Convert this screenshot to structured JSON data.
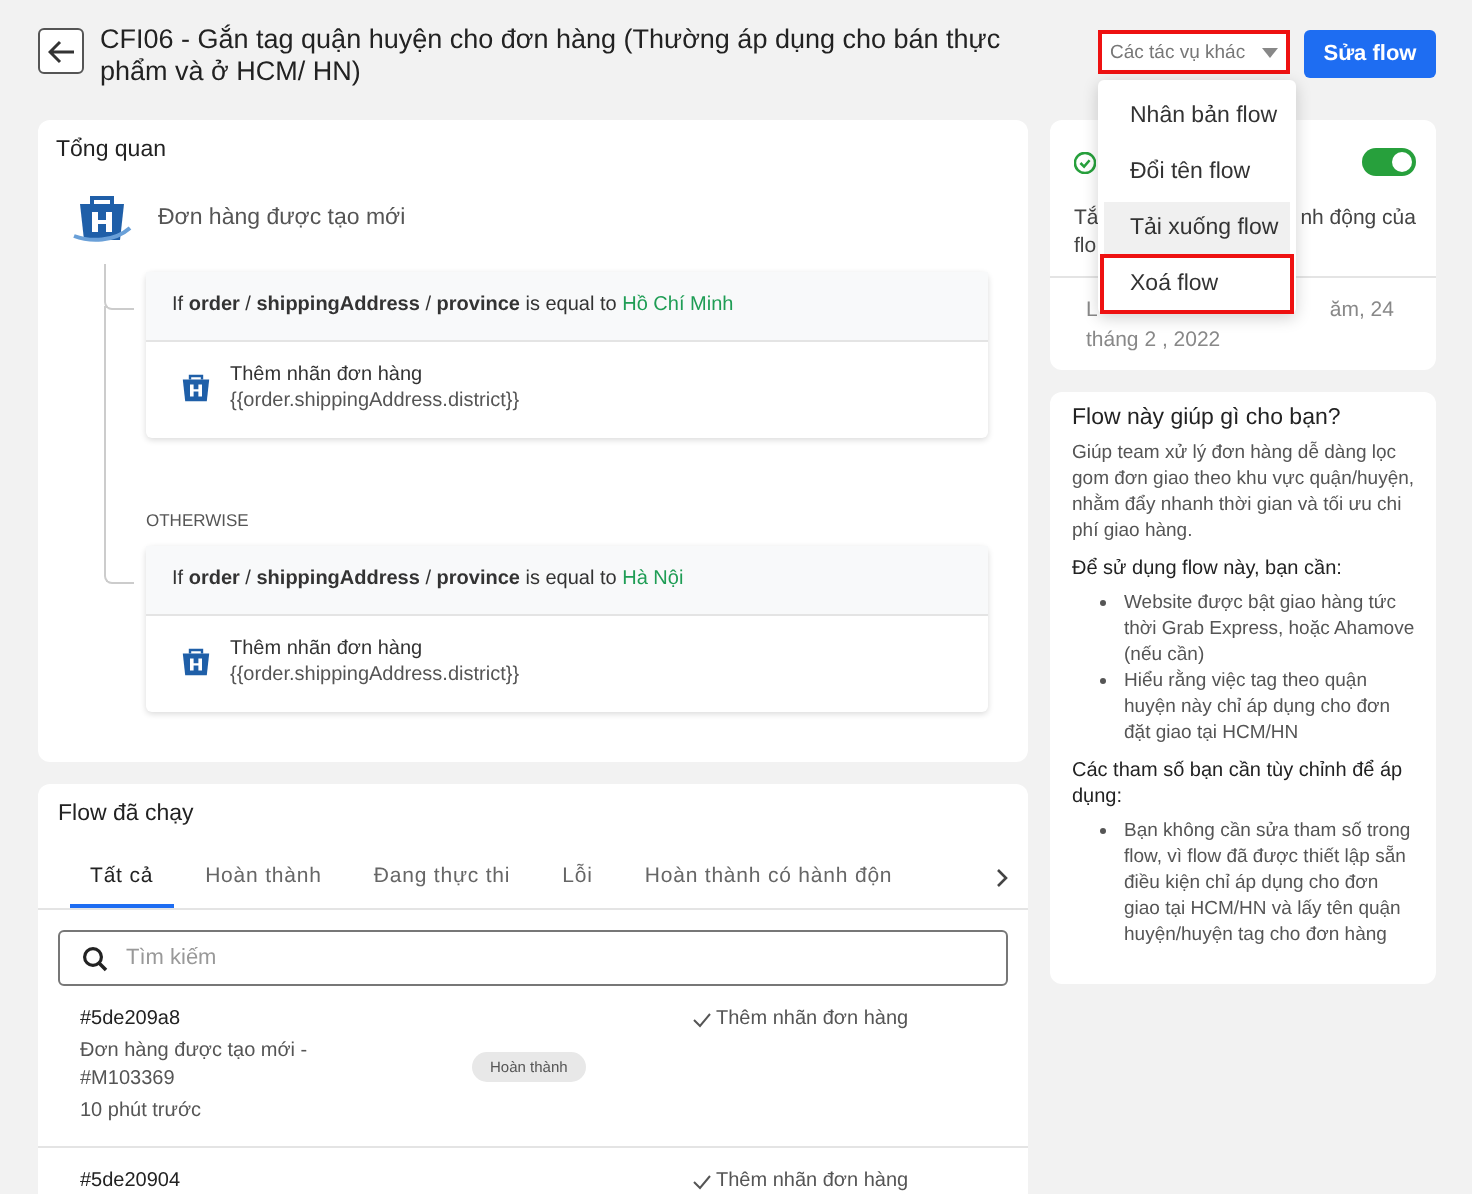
{
  "header": {
    "title": "CFI06 - Gắn tag quận huyện cho đơn hàng (Thường áp dụng cho bán thực phẩm và ở HCM/ HN)",
    "more_actions": "Các tác vụ khác",
    "edit_button": "Sửa flow"
  },
  "actions_menu": {
    "open": true,
    "items": [
      {
        "label": "Nhân bản flow",
        "hovered": false,
        "outlined": false
      },
      {
        "label": "Đổi tên flow",
        "hovered": false,
        "outlined": false
      },
      {
        "label": "Tải xuống flow",
        "hovered": true,
        "outlined": false
      },
      {
        "label": "Xoá flow",
        "hovered": false,
        "outlined": true
      }
    ]
  },
  "overview": {
    "title": "Tổng quan",
    "trigger": "Đơn hàng được tạo mới",
    "otherwise": "OTHERWISE",
    "branches": [
      {
        "condition": "If **order** / **shippingAddress** / **province** is equal to",
        "value": "Hồ Chí Minh",
        "action": "Thêm nhãn đơn hàng",
        "param": "{{order.shippingAddress.district}}"
      },
      {
        "condition": "If **order** / **shippingAddress** / **province** is equal to",
        "value": "Hà Nội",
        "action": "Thêm nhãn đơn hàng",
        "param": "{{order.shippingAddress.district}}"
      }
    ]
  },
  "status": {
    "enabled": true,
    "lines": [
      {
        "left": "Tắ",
        "right": "nh động của"
      },
      {
        "left": "flo"
      }
    ],
    "date_lines": [
      {
        "left": "L",
        "right": "ăm, 24"
      },
      {
        "left": "tháng 2 , 2022"
      }
    ]
  },
  "help": {
    "title": "Flow này giúp gì cho bạn?",
    "sections": [
      {
        "kind": "paragraph",
        "text": "Giúp team xử lý đơn hàng dễ dàng lọc gom đơn giao theo khu vực quận/huyện, nhằm đẩy nhanh thời gian và tối ưu chi phí giao hàng."
      },
      {
        "kind": "heading",
        "text": "Để sử dụng flow này, bạn cần:"
      },
      {
        "kind": "bullets",
        "items": [
          "Website được bật giao hàng tức thời Grab Express, hoặc Ahamove (nếu cần)",
          "Hiểu rằng việc tag theo quận huyện này chỉ áp dụng cho đơn đặt giao tại HCM/HN"
        ]
      },
      {
        "kind": "heading",
        "text": "Các tham số bạn cần tùy chỉnh để áp dụng:"
      },
      {
        "kind": "bullets",
        "items": [
          "Bạn không cần sửa tham số trong flow, vì flow đã được thiết lập sẵn điều kiện chỉ áp dụng cho đơn giao tại HCM/HN và lấy tên quận huyện/huyện tag cho đơn hàng"
        ]
      }
    ]
  },
  "runs": {
    "title": "Flow đã chạy",
    "tabs": [
      {
        "label": "Tất cả",
        "selected": true
      },
      {
        "label": "Hoàn thành",
        "selected": false
      },
      {
        "label": "Đang thực thi",
        "selected": false
      },
      {
        "label": "Lỗi",
        "selected": false
      },
      {
        "label": "Hoàn thành có hành độn",
        "selected": false
      }
    ],
    "search": {
      "placeholder": "Tìm kiếm"
    },
    "rows": [
      {
        "id": "#5de209a8",
        "trigger": "Đơn hàng được tạo mới - #M103369",
        "time": "10 phút trước",
        "status": "Hoàn thành",
        "action": "Thêm nhãn đơn hàng"
      },
      {
        "id": "#5de20904",
        "action": "Thêm nhãn đơn hàng"
      }
    ]
  }
}
